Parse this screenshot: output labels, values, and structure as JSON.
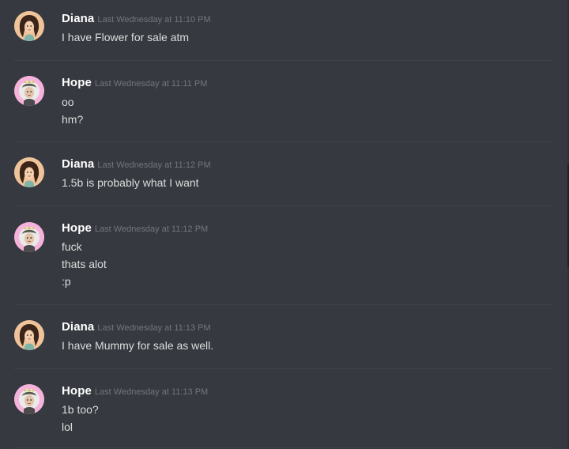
{
  "colors": {
    "background": "#36393f",
    "username": "#ffffff",
    "timestamp": "#72767d",
    "message_text": "#dcddde",
    "divider": "#40434a"
  },
  "messages": [
    {
      "author": "Diana",
      "avatar_icon": "diana-avatar-icon",
      "timestamp": "Last Wednesday at 11:10 PM",
      "lines": [
        "I have Flower for sale atm"
      ]
    },
    {
      "author": "Hope",
      "avatar_icon": "hope-avatar-icon",
      "timestamp": "Last Wednesday at 11:11 PM",
      "lines": [
        "oo",
        "hm?"
      ]
    },
    {
      "author": "Diana",
      "avatar_icon": "diana-avatar-icon",
      "timestamp": "Last Wednesday at 11:12 PM",
      "lines": [
        "1.5b is probably what I want"
      ]
    },
    {
      "author": "Hope",
      "avatar_icon": "hope-avatar-icon",
      "timestamp": "Last Wednesday at 11:12 PM",
      "lines": [
        "fuck",
        "thats alot",
        ":p"
      ]
    },
    {
      "author": "Diana",
      "avatar_icon": "diana-avatar-icon",
      "timestamp": "Last Wednesday at 11:13 PM",
      "lines": [
        "I have Mummy for sale as well."
      ]
    },
    {
      "author": "Hope",
      "avatar_icon": "hope-avatar-icon",
      "timestamp": "Last Wednesday at 11:13 PM",
      "lines": [
        "1b too?",
        "lol"
      ]
    }
  ]
}
